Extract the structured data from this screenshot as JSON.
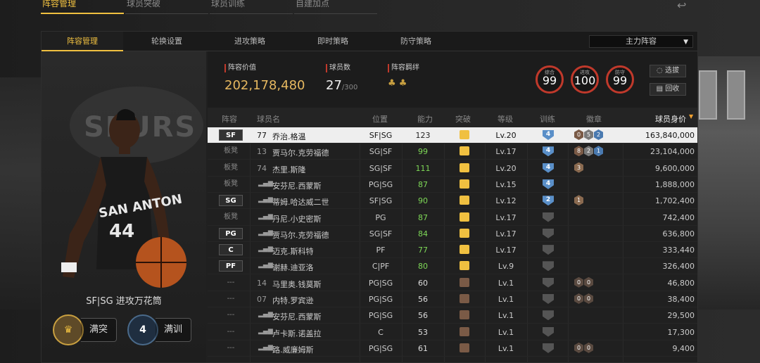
{
  "top_tabs": [
    "阵容管理",
    "球员突破",
    "球员训练",
    "自建加点"
  ],
  "sub_tabs": [
    "阵容管理",
    "轮换设置",
    "进攻策略",
    "即时策略",
    "防守策略"
  ],
  "lineup_select": "主力阵容",
  "player_card": {
    "name": "SF|SG 进攻万花筒",
    "jersey": "44",
    "team_text": "SAN ANTON",
    "breakthrough_label": "满突",
    "training_level": "4",
    "training_label": "满训"
  },
  "stats": {
    "value_label": "阵容价值",
    "value": "202,178,480",
    "count_label": "球员数",
    "count": "27",
    "count_max": "/300",
    "bond_label": "阵容羁绊"
  },
  "rings": [
    {
      "label": "综合",
      "value": "99"
    },
    {
      "label": "进攻",
      "value": "100"
    },
    {
      "label": "防守",
      "value": "99"
    }
  ],
  "buttons": {
    "select": "选拔",
    "recycle": "回收"
  },
  "headers": [
    "阵容",
    "球员名",
    "位置",
    "能力",
    "突破",
    "等级",
    "训练",
    "徽章",
    "球员身价"
  ],
  "rows": [
    {
      "role": "SF",
      "num": "77",
      "name": "乔治.格温",
      "pos": "SF|SG",
      "rating": "123",
      "level": "Lv.20",
      "train": "4",
      "badges": [
        "0",
        "5",
        "2"
      ],
      "price": "163,840,000",
      "sel": true,
      "start": true,
      "crown": "gold",
      "rating_color": "#222"
    },
    {
      "role": "板凳",
      "num": "13",
      "name": "贾马尔.克劳福德",
      "pos": "SG|SF",
      "rating": "99",
      "level": "Lv.17",
      "train": "4",
      "badges": [
        "8",
        "2",
        "1"
      ],
      "price": "23,104,000",
      "crown": "gold",
      "rating_color": "#7ed957"
    },
    {
      "role": "板凳",
      "num": "74",
      "name": "杰里.斯隆",
      "pos": "SG|SF",
      "rating": "111",
      "level": "Lv.20",
      "train": "4",
      "badges": [
        "3"
      ],
      "price": "9,600,000",
      "crown": "gold",
      "rating_color": "#7ed957"
    },
    {
      "role": "板凳",
      "num": "",
      "name": "安芬尼.西蒙斯",
      "pos": "PG|SG",
      "rating": "87",
      "level": "Lv.15",
      "train": "4",
      "badges": [],
      "price": "1,888,000",
      "crown": "gold",
      "rating_color": "#7ed957"
    },
    {
      "role": "SG",
      "num": "",
      "name": "蒂姆.哈达威二世",
      "pos": "SF|SG",
      "rating": "90",
      "level": "Lv.12",
      "train": "2",
      "badges": [
        "1"
      ],
      "price": "1,702,400",
      "start": true,
      "crown": "gold",
      "rating_color": "#7ed957"
    },
    {
      "role": "板凳",
      "num": "",
      "name": "丹尼.小史密斯",
      "pos": "PG",
      "rating": "87",
      "level": "Lv.17",
      "train": "",
      "badges": [],
      "price": "742,400",
      "crown": "gold",
      "rating_color": "#7ed957"
    },
    {
      "role": "PG",
      "num": "",
      "name": "贾马尔.克劳福德",
      "pos": "SG|SF",
      "rating": "84",
      "level": "Lv.17",
      "train": "",
      "badges": [],
      "price": "636,800",
      "start": true,
      "crown": "gold",
      "rating_color": "#7ed957"
    },
    {
      "role": "C",
      "num": "",
      "name": "迈克.斯科特",
      "pos": "PF",
      "rating": "77",
      "level": "Lv.17",
      "train": "",
      "badges": [],
      "price": "333,440",
      "start": true,
      "crown": "gold",
      "rating_color": "#7ed957"
    },
    {
      "role": "PF",
      "num": "",
      "name": "谢赫.迪亚洛",
      "pos": "C|PF",
      "rating": "80",
      "level": "Lv.9",
      "train": "",
      "badges": [],
      "price": "326,400",
      "start": true,
      "crown": "gold",
      "rating_color": "#7ed957"
    },
    {
      "role": "---",
      "num": "14",
      "name": "马里奥.钱莫斯",
      "pos": "PG|SG",
      "rating": "60",
      "level": "Lv.1",
      "train": "",
      "badges": [
        "0",
        "0"
      ],
      "price": "46,800",
      "crown": "low",
      "rating_color": "#ddd"
    },
    {
      "role": "---",
      "num": "07",
      "name": "内特.罗宾逊",
      "pos": "PG|SG",
      "rating": "56",
      "level": "Lv.1",
      "train": "",
      "badges": [
        "0",
        "0"
      ],
      "price": "38,400",
      "crown": "low",
      "rating_color": "#ddd"
    },
    {
      "role": "---",
      "num": "",
      "name": "安芬尼.西蒙斯",
      "pos": "PG|SG",
      "rating": "56",
      "level": "Lv.1",
      "train": "",
      "badges": [],
      "price": "29,500",
      "crown": "low",
      "rating_color": "#ddd"
    },
    {
      "role": "---",
      "num": "",
      "name": "卢卡斯.诺盖拉",
      "pos": "C",
      "rating": "53",
      "level": "Lv.1",
      "train": "",
      "badges": [],
      "price": "17,300",
      "crown": "low",
      "rating_color": "#ddd"
    },
    {
      "role": "---",
      "num": "",
      "name": "路.威廉姆斯",
      "pos": "PG|SG",
      "rating": "61",
      "level": "Lv.1",
      "train": "",
      "badges": [
        "0",
        "0"
      ],
      "price": "9,400",
      "crown": "low",
      "rating_color": "#ddd"
    }
  ],
  "colors": {
    "accent": "#f0c040",
    "ring": "#c0392b",
    "positive": "#7ed957"
  }
}
